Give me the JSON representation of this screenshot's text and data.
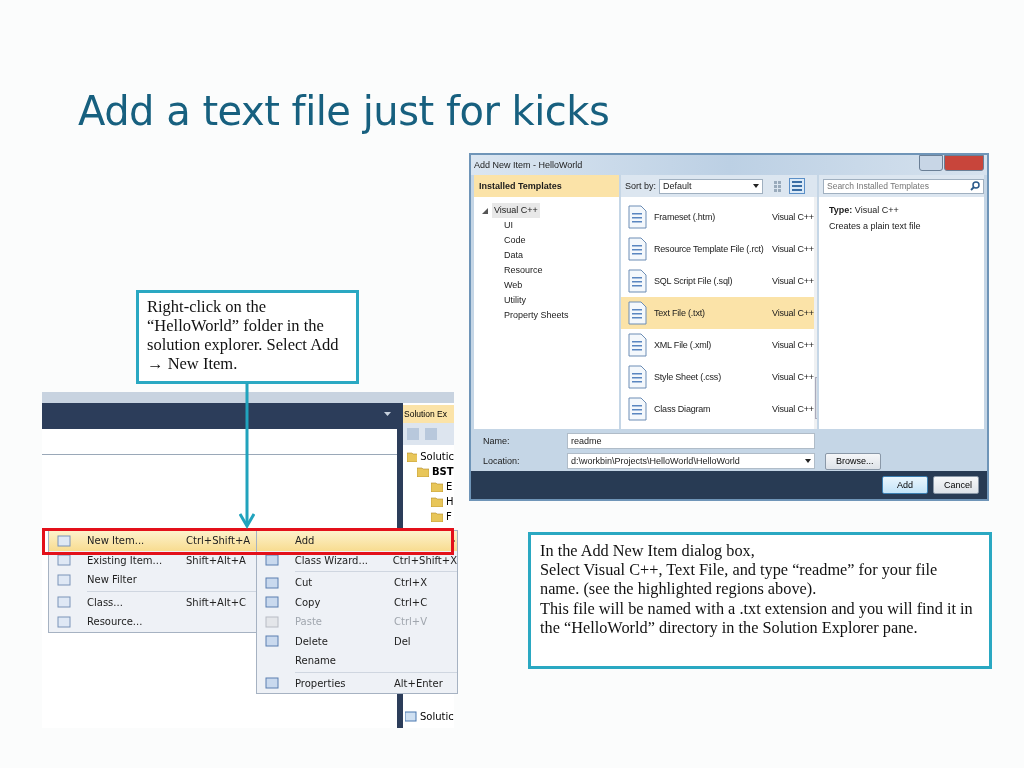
{
  "title": "Add a text file just for kicks",
  "callouts": [
    "Right-click on the “HelloWorld” folder in the solution explorer. Select Add → New Item.",
    "In the Add New Item dialog box,\nSelect Visual C++, Text File, and type “readme” for your file name. (see the highlighted regions above).\nThis file will be named with a .txt extension and you will find it in the “HelloWorld” directory in the Solution Explorer pane."
  ],
  "dialog": {
    "title": "Add New Item - HelloWorld",
    "sidebar_header": "Installed Templates",
    "tree": {
      "label": "Visual C++",
      "expanded": true,
      "selected": true,
      "children": [
        {
          "label": "UI",
          "selected": false
        },
        {
          "label": "Code",
          "selected": false
        },
        {
          "label": "Data",
          "selected": false
        },
        {
          "label": "Resource",
          "selected": false
        },
        {
          "label": "Web",
          "selected": false
        },
        {
          "label": "Utility",
          "selected": false
        },
        {
          "label": "Property Sheets",
          "selected": false
        }
      ]
    },
    "sort_label": "Sort by:",
    "sort_value": "Default",
    "search": {
      "placeholder": "Search Installed Templates"
    },
    "templates": [
      {
        "name": "Frameset (.htm)",
        "language": "Visual C++",
        "selected": false
      },
      {
        "name": "Resource Template File (.rct)",
        "language": "Visual C++",
        "selected": false
      },
      {
        "name": "SQL Script File (.sql)",
        "language": "Visual C++",
        "selected": false
      },
      {
        "name": "Text File (.txt)",
        "language": "Visual C++",
        "selected": true
      },
      {
        "name": "XML File (.xml)",
        "language": "Visual C++",
        "selected": false
      },
      {
        "name": "Style Sheet (.css)",
        "language": "Visual C++",
        "selected": false
      },
      {
        "name": "Class Diagram",
        "language": "Visual C++",
        "selected": false
      }
    ],
    "info": {
      "type_label": "Type:",
      "type_value": "Visual C++",
      "description": "Creates a plain text file"
    },
    "name_label": "Name:",
    "name_value": "readme",
    "location_label": "Location:",
    "location_value": "d:\\workbin\\Projects\\HelloWorld\\HelloWorld",
    "browse": "Browse...",
    "add": "Add",
    "cancel": "Cancel"
  },
  "ide": {
    "panel_title": "Solution Ex",
    "tree": [
      "Solutic",
      "BST",
      "E",
      "H",
      "F"
    ],
    "bottom_tab": "Solutic"
  },
  "add_menu": [
    {
      "label": "New Item...",
      "shortcut": "Ctrl+Shift+A",
      "selected": true
    },
    {
      "label": "Existing Item...",
      "shortcut": "Shift+Alt+A",
      "selected": false
    },
    {
      "label": "New Filter",
      "selected": false
    },
    {
      "label": "Class...",
      "shortcut": "Shift+Alt+C",
      "selected": false
    },
    {
      "label": "Resource...",
      "selected": false
    }
  ],
  "context_menu": [
    {
      "label": "Add",
      "selected": true,
      "disabled": false
    },
    {
      "label": "Class Wizard...",
      "shortcut": "Ctrl+Shift+X",
      "selected": false,
      "disabled": false
    },
    {
      "label": "Cut",
      "shortcut": "Ctrl+X",
      "selected": false,
      "disabled": false
    },
    {
      "label": "Copy",
      "shortcut": "Ctrl+C",
      "selected": false,
      "disabled": false
    },
    {
      "label": "Paste",
      "shortcut": "Ctrl+V",
      "selected": false,
      "disabled": true
    },
    {
      "label": "Delete",
      "shortcut": "Del",
      "selected": false,
      "disabled": false
    },
    {
      "label": "Rename",
      "selected": false,
      "disabled": false
    },
    {
      "label": "Properties",
      "shortcut": "Alt+Enter",
      "selected": false,
      "disabled": false
    }
  ]
}
